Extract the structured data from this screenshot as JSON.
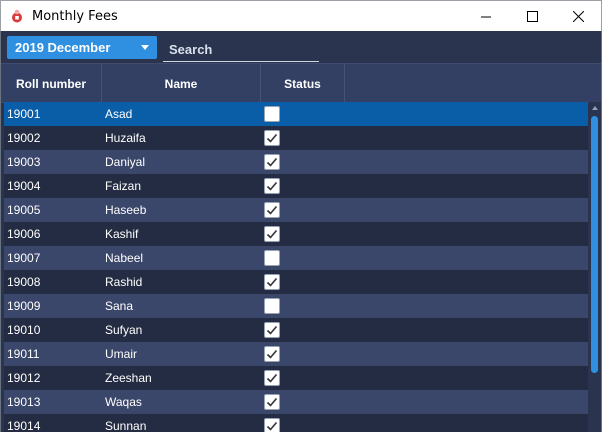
{
  "window": {
    "title": "Monthly Fees",
    "controls": [
      "minimize-icon",
      "maximize-icon",
      "close-icon"
    ]
  },
  "toolbar": {
    "month_selected": "2019 December",
    "search_placeholder": "Search",
    "search_value": ""
  },
  "table": {
    "headers": [
      "Roll number",
      "Name",
      "Status"
    ],
    "rows": [
      {
        "roll": "19001",
        "name": "Asad",
        "paid": false,
        "selected": true
      },
      {
        "roll": "19002",
        "name": "Huzaifa",
        "paid": true
      },
      {
        "roll": "19003",
        "name": "Daniyal",
        "paid": true
      },
      {
        "roll": "19004",
        "name": "Faizan",
        "paid": true
      },
      {
        "roll": "19005",
        "name": "Haseeb",
        "paid": true
      },
      {
        "roll": "19006",
        "name": "Kashif",
        "paid": true
      },
      {
        "roll": "19007",
        "name": "Nabeel",
        "paid": false
      },
      {
        "roll": "19008",
        "name": "Rashid",
        "paid": true
      },
      {
        "roll": "19009",
        "name": "Sana",
        "paid": false
      },
      {
        "roll": "19010",
        "name": "Sufyan",
        "paid": true
      },
      {
        "roll": "19011",
        "name": "Umair",
        "paid": true
      },
      {
        "roll": "19012",
        "name": "Zeeshan",
        "paid": true
      },
      {
        "roll": "19013",
        "name": "Waqas",
        "paid": true
      },
      {
        "roll": "19014",
        "name": "Sunnan",
        "paid": true
      }
    ]
  },
  "colors": {
    "app_bg": "#2a344e",
    "header_bg": "#334064",
    "row_even": "#3a466a",
    "row_odd": "#232c42",
    "selected_row": "#0a5ea8",
    "accent": "#2f8fe0"
  }
}
